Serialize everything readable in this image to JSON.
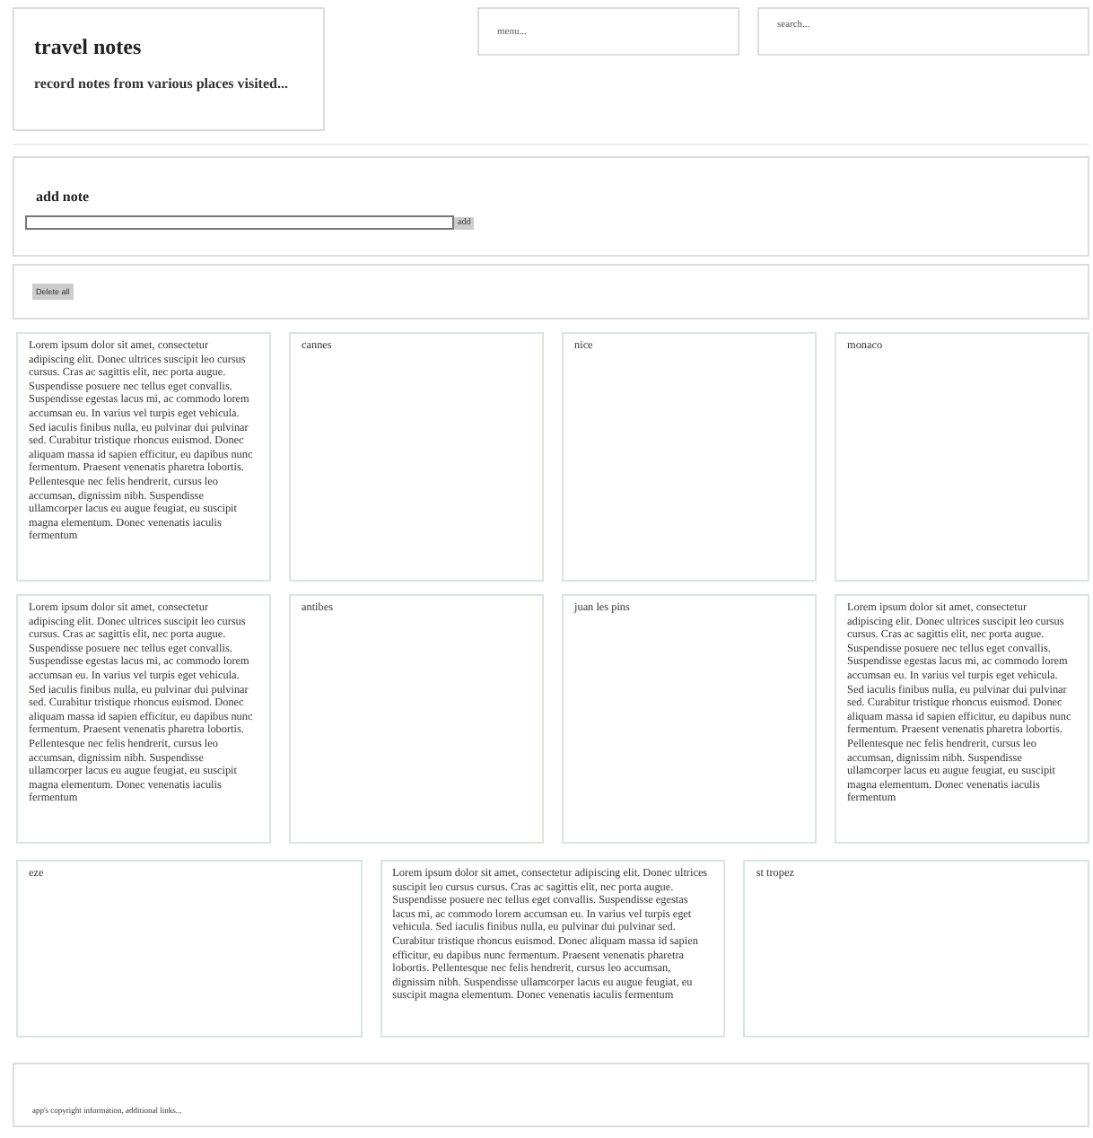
{
  "header": {
    "title": "travel notes",
    "subtitle": "record notes from various places visited..."
  },
  "menu": {
    "text": "menu..."
  },
  "search": {
    "placeholder": "search..."
  },
  "add_note": {
    "heading": "add note",
    "button": "add"
  },
  "delete_all": {
    "button": "Delete all"
  },
  "note_rows": [
    {
      "notes": [
        {
          "text": "Lorem ipsum dolor sit amet, consectetur adipiscing elit. Donec ultrices suscipit leo cursus cursus. Cras ac sagittis elit, nec porta augue. Suspendisse posuere nec tellus eget convallis. Suspendisse egestas lacus mi, ac commodo lorem accumsan eu. In varius vel turpis eget vehicula. Sed iaculis finibus nulla, eu pulvinar dui pulvinar sed. Curabitur tristique rhoncus euismod. Donec aliquam massa id sapien efficitur, eu dapibus nunc fermentum. Praesent venenatis pharetra lobortis. Pellentesque nec felis hendrerit, cursus leo accumsan, dignissim nibh. Suspendisse ullamcorper lacus eu augue feugiat, eu suscipit magna elementum. Donec venenatis iaculis fermentum"
        },
        {
          "text": "cannes"
        },
        {
          "text": "nice"
        },
        {
          "text": "monaco"
        }
      ]
    },
    {
      "notes": [
        {
          "text": "Lorem ipsum dolor sit amet, consectetur adipiscing elit. Donec ultrices suscipit leo cursus cursus. Cras ac sagittis elit, nec porta augue. Suspendisse posuere nec tellus eget convallis. Suspendisse egestas lacus mi, ac commodo lorem accumsan eu. In varius vel turpis eget vehicula. Sed iaculis finibus nulla, eu pulvinar dui pulvinar sed. Curabitur tristique rhoncus euismod. Donec aliquam massa id sapien efficitur, eu dapibus nunc fermentum. Praesent venenatis pharetra lobortis. Pellentesque nec felis hendrerit, cursus leo accumsan, dignissim nibh. Suspendisse ullamcorper lacus eu augue feugiat, eu suscipit magna elementum. Donec venenatis iaculis fermentum"
        },
        {
          "text": "antibes"
        },
        {
          "text": "juan les pins"
        },
        {
          "text": "Lorem ipsum dolor sit amet, consectetur adipiscing elit. Donec ultrices suscipit leo cursus cursus. Cras ac sagittis elit, nec porta augue. Suspendisse posuere nec tellus eget convallis. Suspendisse egestas lacus mi, ac commodo lorem accumsan eu. In varius vel turpis eget vehicula. Sed iaculis finibus nulla, eu pulvinar dui pulvinar sed. Curabitur tristique rhoncus euismod. Donec aliquam massa id sapien efficitur, eu dapibus nunc fermentum. Praesent venenatis pharetra lobortis. Pellentesque nec felis hendrerit, cursus leo accumsan, dignissim nibh. Suspendisse ullamcorper lacus eu augue feugiat, eu suscipit magna elementum. Donec venenatis iaculis fermentum"
        }
      ]
    },
    {
      "notes": [
        {
          "text": "eze"
        },
        {
          "text": "Lorem ipsum dolor sit amet, consectetur adipiscing elit. Donec ultrices suscipit leo cursus cursus. Cras ac sagittis elit, nec porta augue. Suspendisse posuere nec tellus eget convallis. Suspendisse egestas lacus mi, ac commodo lorem accumsan eu. In varius vel turpis eget vehicula. Sed iaculis finibus nulla, eu pulvinar dui pulvinar sed. Curabitur tristique rhoncus euismod. Donec aliquam massa id sapien efficitur, eu dapibus nunc fermentum. Praesent venenatis pharetra lobortis. Pellentesque nec felis hendrerit, cursus leo accumsan, dignissim nibh. Suspendisse ullamcorper lacus eu augue feugiat, eu suscipit magna elementum. Donec venenatis iaculis fermentum"
        },
        {
          "text": "st tropez"
        }
      ]
    }
  ],
  "footer": {
    "text": "app's copyright information, additional links..."
  }
}
